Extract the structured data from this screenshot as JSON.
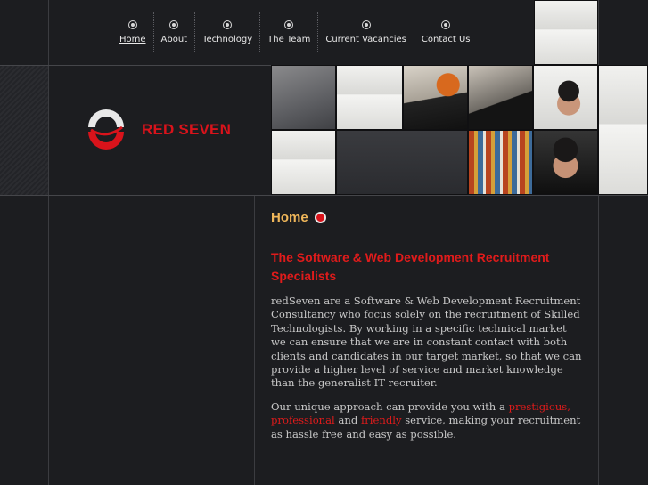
{
  "nav": {
    "items": [
      {
        "label": "Home"
      },
      {
        "label": "About"
      },
      {
        "label": "Technology"
      },
      {
        "label": "The Team"
      },
      {
        "label": "Current Vacancies"
      },
      {
        "label": "Contact Us"
      }
    ]
  },
  "brand": {
    "name": "RED SEVEN"
  },
  "page": {
    "heading": "Home",
    "subheading": "The Software & Web Development Recruitment Specialists",
    "paragraph1": "redSeven are a Software & Web Development Recruitment Consultancy who focus solely on the recruitment of Skilled Technologists. By working in a specific technical market we can ensure that we are in constant contact with both clients and candidates in our target market, so that we can provide a higher level of service and market knowledge than the generalist IT recruiter.",
    "paragraph2": {
      "intro": "Our unique approach can provide you with a",
      "word1": "prestigious,",
      "word2": "professional",
      "and": "and",
      "word3": "friendly",
      "outro": "service, making your recruitment as hassle free and easy as possible."
    }
  },
  "colors": {
    "accent": "#e01b1b",
    "heading": "#f0b75a",
    "background": "#1c1d20"
  }
}
